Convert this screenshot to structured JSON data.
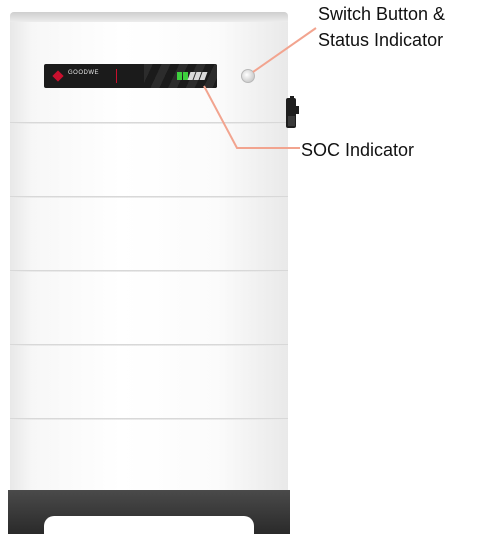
{
  "labels": {
    "switch_line1": "Switch Button &",
    "switch_line2": "Status Indicator",
    "soc": "SOC Indicator"
  },
  "brand": {
    "logo_text": "GOODWE",
    "accent_color": "#c8102e"
  },
  "colors": {
    "callout_line": "#f2a48f",
    "soc_green": "#3ecf3e"
  },
  "icons": {
    "switch": "switch-button-icon",
    "soc": "soc-indicator-icon",
    "connector": "cable-connector-icon"
  }
}
